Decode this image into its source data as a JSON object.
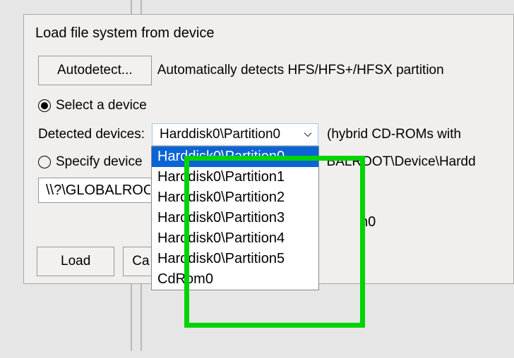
{
  "panel": {
    "title": "Load file system from device"
  },
  "autodetect": {
    "button_label": "Autodetect...",
    "description": "Automatically detects HFS/HFS+/HFSX partition"
  },
  "select_device": {
    "radio_label": "Select a device",
    "checked": true
  },
  "detected_devices": {
    "label": "Detected devices:",
    "selected": "Harddisk0\\Partition0",
    "after_text": "(hybrid CD-ROMs with",
    "options": [
      "Harddisk0\\Partition0",
      "Harddisk0\\Partition1",
      "Harddisk0\\Partition2",
      "Harddisk0\\Partition3",
      "Harddisk0\\Partition4",
      "Harddisk0\\Partition5",
      "CdRom0"
    ]
  },
  "specify_device": {
    "radio_label": "Specify device",
    "checked": false,
    "right_text": "BALROOT\\Device\\Hardd"
  },
  "path_input": {
    "value": "\\\\?\\GLOBALROOT"
  },
  "path_display_suffix": "n0",
  "buttons": {
    "load": "Load",
    "cancel": "Ca"
  },
  "colors": {
    "highlight_border": "#00d400",
    "selection_bg": "#0a64d6"
  }
}
